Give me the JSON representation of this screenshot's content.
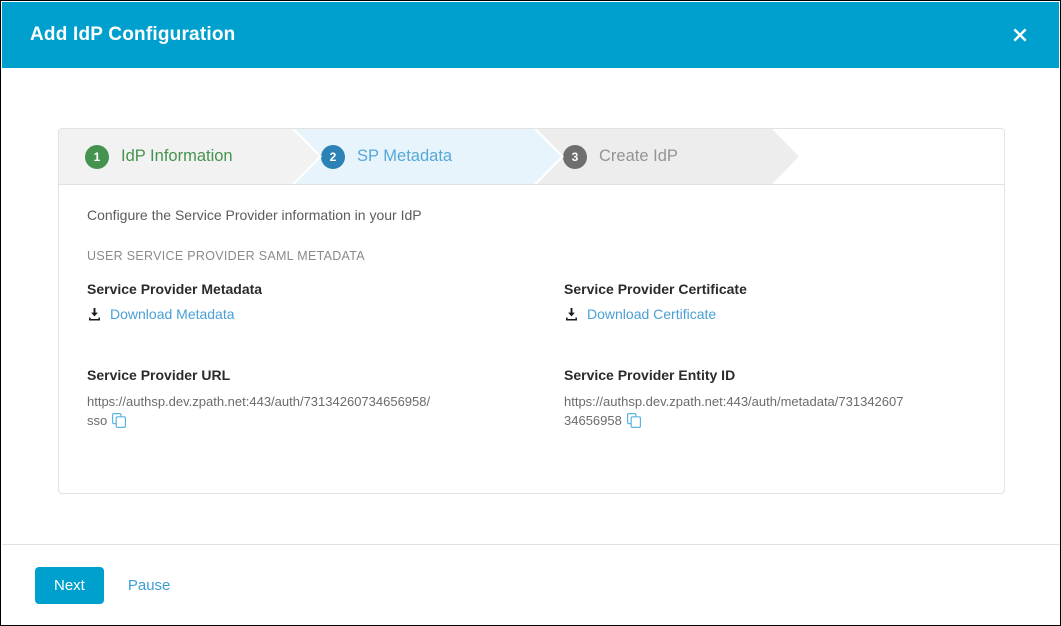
{
  "window": {
    "title": "Add IdP Configuration",
    "close_icon": "close-x-icon"
  },
  "stepper": {
    "steps": [
      {
        "number": "1",
        "label": "IdP Information",
        "state": "completed",
        "color": "#45934f"
      },
      {
        "number": "2",
        "label": "SP Metadata",
        "state": "active",
        "color": "#2d82b5"
      },
      {
        "number": "3",
        "label": "Create IdP",
        "state": "pending",
        "color": "#6e6e6e"
      }
    ]
  },
  "body": {
    "intro": "Configure the Service Provider information in your IdP",
    "section_title": "USER SERVICE PROVIDER SAML METADATA",
    "fields": [
      {
        "label": "Service Provider Metadata",
        "link_label": "Download Metadata",
        "icon": "download-icon",
        "type": "download"
      },
      {
        "label": "Service Provider Certificate",
        "link_label": "Download Certificate",
        "icon": "download-icon",
        "type": "download"
      },
      {
        "label": "Service Provider URL",
        "value": "https://authsp.dev.zpath.net:443/auth/73134260734656958/sso",
        "icon": "copy-icon",
        "type": "url"
      },
      {
        "label": "Service Provider Entity ID",
        "value": "https://authsp.dev.zpath.net:443/auth/metadata/73134260734656958",
        "icon": "copy-icon",
        "type": "url"
      }
    ]
  },
  "footer": {
    "next_label": "Next",
    "pause_label": "Pause"
  },
  "colors": {
    "header_bg": "#00a0ce",
    "primary_button": "#00a0ce",
    "link": "#3d9dd6",
    "step_done": "#45934f",
    "step_active": "#2d82b5",
    "step_pending": "#6e6e6e"
  }
}
